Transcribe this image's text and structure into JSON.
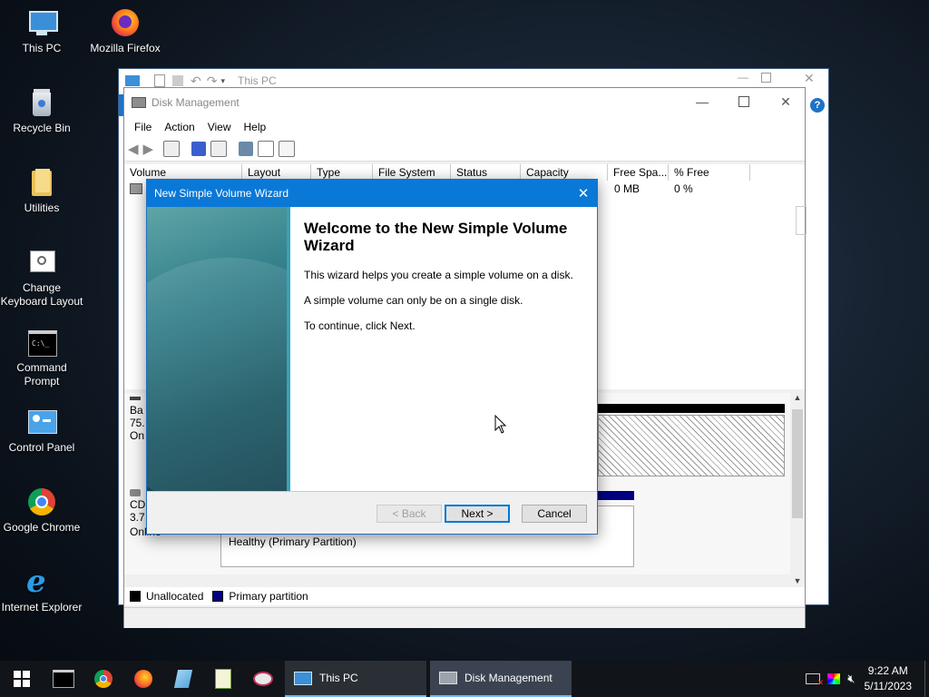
{
  "desktop": {
    "icons": [
      {
        "label": "This PC"
      },
      {
        "label": "Mozilla Firefox"
      },
      {
        "label": "Recycle Bin"
      },
      {
        "label": "Utilities"
      },
      {
        "label": "Change Keyboard Layout"
      },
      {
        "label": "Command Prompt"
      },
      {
        "label": "Control Panel"
      },
      {
        "label": "Google Chrome"
      },
      {
        "label": "Internet Explorer"
      }
    ]
  },
  "this_pc_window": {
    "title": "This PC"
  },
  "disk_management": {
    "title": "Disk Management",
    "menu": [
      "File",
      "Action",
      "View",
      "Help"
    ],
    "columns": [
      "Volume",
      "Layout",
      "Type",
      "File System",
      "Status",
      "Capacity",
      "Free Spa...",
      "% Free"
    ],
    "row0": {
      "free_space": "0 MB",
      "percent_free": "0 %"
    },
    "disk0": {
      "line1": "Ba",
      "line2": "75.",
      "line3": "On"
    },
    "cd0": {
      "line1": "CD",
      "line2": "3.7",
      "status": "Online",
      "partition_status": "Healthy (Primary Partition)"
    },
    "legend": [
      "Unallocated",
      "Primary partition"
    ]
  },
  "wizard": {
    "title": "New Simple Volume Wizard",
    "heading": "Welcome to the New Simple Volume Wizard",
    "p1": "This wizard helps you create a simple volume on a disk.",
    "p2": "A simple volume can only be on a single disk.",
    "p3": "To continue, click Next.",
    "back_label": "< Back",
    "next_label": "Next >",
    "cancel_label": "Cancel"
  },
  "taskbar": {
    "apps": [
      "This PC",
      "Disk Management"
    ],
    "time": "9:22 AM",
    "date": "5/11/2023"
  }
}
